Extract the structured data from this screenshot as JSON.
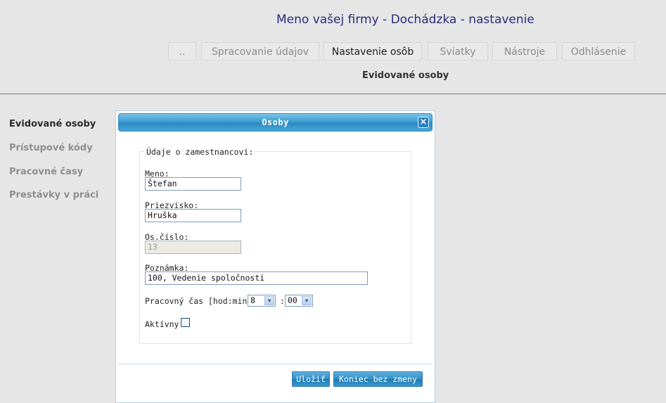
{
  "header": {
    "title": "Meno vašej firmy - Dochádzka - nastavenie"
  },
  "nav": {
    "tabs": [
      {
        "label": ".."
      },
      {
        "label": "Spracovanie údajov"
      },
      {
        "label": "Nastavenie osôb"
      },
      {
        "label": "Sviatky"
      },
      {
        "label": "Nástroje"
      },
      {
        "label": "Odhlásenie"
      }
    ],
    "active_tab": "Nastavenie osôb",
    "subtitle": "Evidované osoby"
  },
  "sidebar": {
    "items": [
      {
        "label": "Evidované osoby",
        "active": true
      },
      {
        "label": "Prístupové kódy",
        "active": false
      },
      {
        "label": "Pracovné časy",
        "active": false
      },
      {
        "label": "Prestávky v práci",
        "active": false
      }
    ]
  },
  "dialog": {
    "title": "Osoby",
    "close_icon": "close-icon",
    "legend": "Údaje o zamestnancovi:",
    "meno_label": "Meno:",
    "meno_value": "Štefan",
    "priezvisko_label": "Priezvisko:",
    "priezvisko_value": "Hruška",
    "oscislo_label": "Os.číslo:",
    "oscislo_value": "13",
    "poznamka_label": "Poznámka:",
    "poznamka_value": "100, Vedenie spoločnosti",
    "pracovny_cas_label": "Pracovný čas [hod:min]:",
    "hours_value": "8",
    "time_separator": ":",
    "minutes_value": "00",
    "aktivny_label": "Aktívny",
    "aktivny_checked": false,
    "save_label": "Uložiť",
    "cancel_label": "Koniec bez zmeny"
  },
  "colors": {
    "accent": "#2a8ac2",
    "title_text": "#2a2a78",
    "background": "#e6e6e6"
  }
}
